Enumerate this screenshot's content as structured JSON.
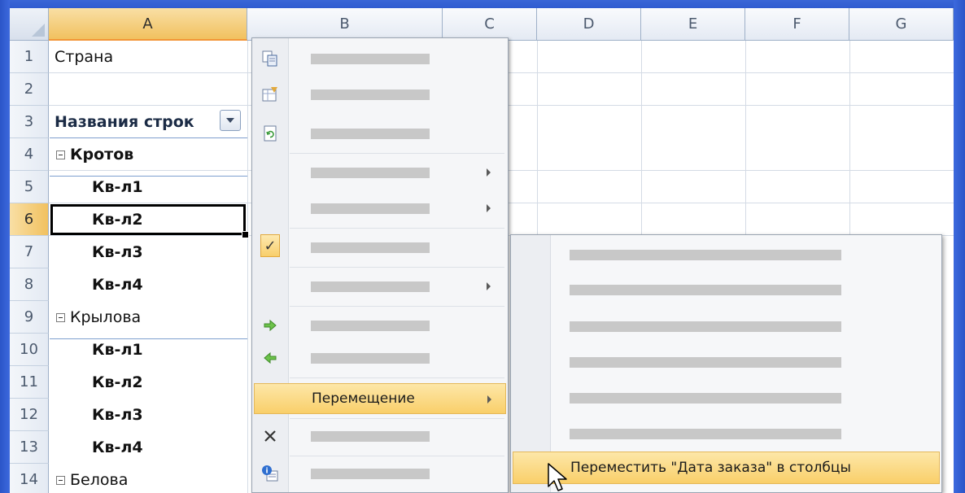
{
  "columns": [
    "A",
    "B",
    "C",
    "D",
    "E",
    "F",
    "G"
  ],
  "rows": [
    {
      "num": "1",
      "text": "Страна"
    },
    {
      "num": "2",
      "text": ""
    },
    {
      "num": "3",
      "text": "Названия строк"
    },
    {
      "num": "4",
      "text": "Кротов"
    },
    {
      "num": "5",
      "text": "Кв-л1"
    },
    {
      "num": "6",
      "text": "Кв-л2"
    },
    {
      "num": "7",
      "text": "Кв-л3"
    },
    {
      "num": "8",
      "text": "Кв-л4"
    },
    {
      "num": "9",
      "text": "Крылова"
    },
    {
      "num": "10",
      "text": "Кв-л1"
    },
    {
      "num": "11",
      "text": "Кв-л2"
    },
    {
      "num": "12",
      "text": "Кв-л3"
    },
    {
      "num": "13",
      "text": "Кв-л4"
    },
    {
      "num": "14",
      "text": "Белова"
    }
  ],
  "selected_column": "A",
  "selected_row": "6",
  "context_menu": {
    "move_label": "Перемещение"
  },
  "submenu": {
    "move_to_columns_label": "Переместить \"Дата заказа\" в столбцы"
  },
  "colors": {
    "highlight": "#f9cf6a",
    "frame": "#2f5bd0"
  }
}
